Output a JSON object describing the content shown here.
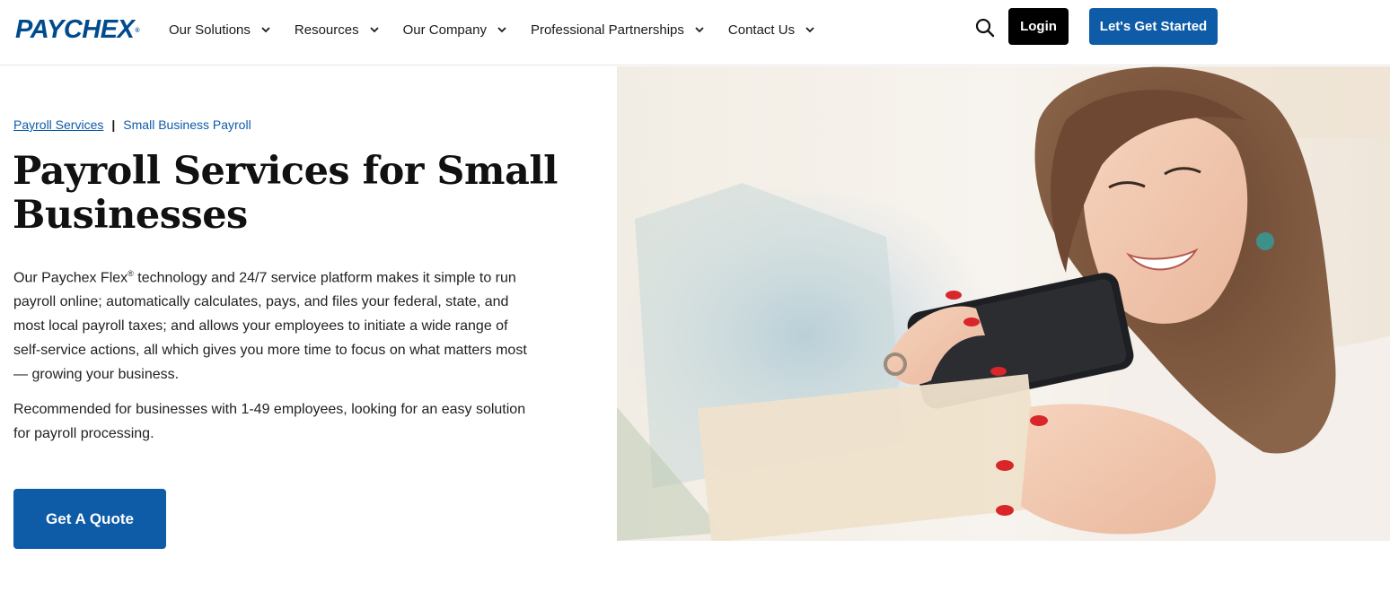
{
  "header": {
    "logo_text": "PAYCHEX",
    "logo_mark": "®",
    "nav": [
      {
        "label": "Our Solutions",
        "icon": "chevron-down-icon"
      },
      {
        "label": "Resources",
        "icon": "chevron-down-icon"
      },
      {
        "label": "Our Company",
        "icon": "chevron-down-icon"
      },
      {
        "label": "Professional Partnerships",
        "icon": "chevron-down-icon"
      },
      {
        "label": "Contact Us",
        "icon": "chevron-down-icon"
      }
    ],
    "search_icon": "search-icon",
    "login_label": "Login",
    "start_label": "Let's Get Started"
  },
  "breadcrumb": {
    "link": "Payroll Services",
    "separator": "|",
    "current": "Small Business Payroll"
  },
  "main": {
    "title": "Payroll Services for Small Businesses",
    "paragraph1_pre": "Our Paychex Flex",
    "paragraph1_mark": "®",
    "paragraph1_post": " technology and 24/7 service platform makes it simple to run payroll online; automatically calculates, pays, and files your federal, state, and most local payroll taxes; and allows your employees to initiate a wide range of self-service actions, all which gives you more time to focus on what matters most — growing your business.",
    "paragraph2": "Recommended for businesses with 1-49 employees, looking for an easy solution for payroll processing.",
    "cta_label": "Get A Quote"
  },
  "colors": {
    "brand_blue": "#0e5ba8",
    "logo_blue": "#004b8d",
    "login_bg": "#000000"
  },
  "hero": {
    "image": "woman-holding-phone-and-paper-photo"
  }
}
